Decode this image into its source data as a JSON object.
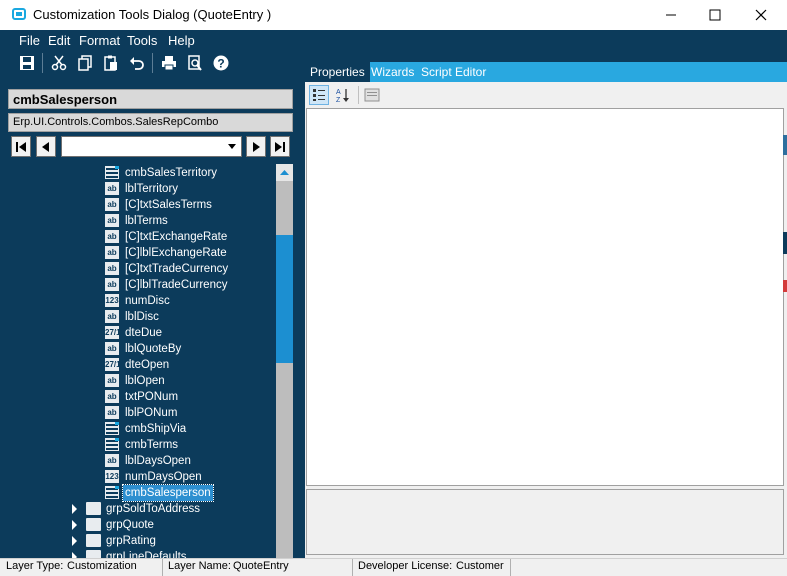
{
  "window": {
    "title": "Customization Tools Dialog  (QuoteEntry )",
    "controls": [
      "minimize",
      "maximize",
      "close"
    ]
  },
  "menu": [
    "File",
    "Edit",
    "Format",
    "Tools",
    "Help"
  ],
  "toolbar": {
    "icons": [
      "save-icon",
      "cut-icon",
      "copy-icon",
      "paste-icon",
      "undo-icon",
      "print-icon",
      "print-preview-icon",
      "help-icon"
    ]
  },
  "selected_control": {
    "name": "cmbSalesperson",
    "type": "Erp.UI.Controls.Combos.SalesRepCombo"
  },
  "navigator": {
    "combo_value": ""
  },
  "tree": {
    "items": [
      {
        "label": "cmbSalesTerritory",
        "icon": "combo"
      },
      {
        "label": "lblTerritory",
        "icon": "ab"
      },
      {
        "label": "[C]txtSalesTerms",
        "icon": "ab"
      },
      {
        "label": "lblTerms",
        "icon": "ab"
      },
      {
        "label": "[C]txtExchangeRate",
        "icon": "ab"
      },
      {
        "label": "[C]lblExchangeRate",
        "icon": "ab"
      },
      {
        "label": "[C]txtTradeCurrency",
        "icon": "ab"
      },
      {
        "label": "[C]lblTradeCurrency",
        "icon": "ab"
      },
      {
        "label": "numDisc",
        "icon": "123"
      },
      {
        "label": "lblDisc",
        "icon": "ab"
      },
      {
        "label": "dteDue",
        "icon": "27"
      },
      {
        "label": "lblQuoteBy",
        "icon": "ab"
      },
      {
        "label": "dteOpen",
        "icon": "27"
      },
      {
        "label": "lblOpen",
        "icon": "ab"
      },
      {
        "label": "txtPONum",
        "icon": "ab"
      },
      {
        "label": "lblPONum",
        "icon": "ab"
      },
      {
        "label": "cmbShipVia",
        "icon": "combo"
      },
      {
        "label": "cmbTerms",
        "icon": "combo"
      },
      {
        "label": "lblDaysOpen",
        "icon": "ab"
      },
      {
        "label": "numDaysOpen",
        "icon": "123"
      },
      {
        "label": "cmbSalesperson",
        "icon": "combo",
        "selected": true
      }
    ],
    "groups": [
      "grpSoldToAddress",
      "grpQuote",
      "grpRating",
      "grpLineDefaults"
    ]
  },
  "tabs": [
    {
      "label": "Properties",
      "active": true
    },
    {
      "label": "Wizards",
      "active": false
    },
    {
      "label": "Script Editor",
      "active": false
    }
  ],
  "status": {
    "layer_type_label": "Layer Type:",
    "layer_type_value": "Customization",
    "layer_name_label": "Layer Name:",
    "layer_name_value": "QuoteEntry",
    "license_label": "Developer License:",
    "license_value": "Customer"
  },
  "colors": {
    "navy": "#0c3b5b",
    "accent": "#29a8e0",
    "selection": "#2d8fd0"
  }
}
